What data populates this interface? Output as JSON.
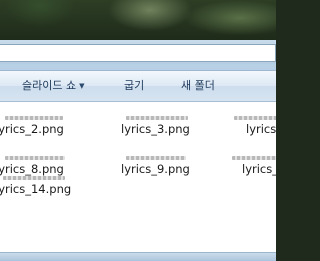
{
  "toolbar": {
    "slideshow_label": "슬라이드 쇼",
    "burn_label": "굽기",
    "new_folder_label": "새 폴더"
  },
  "files": [
    {
      "name": "lyrics_2.png"
    },
    {
      "name": "lyrics_3.png"
    },
    {
      "name": "lyrics_"
    },
    {
      "name": "lyrics_8.png"
    },
    {
      "name": "lyrics_9.png"
    },
    {
      "name": "lyrics_"
    },
    {
      "name": "lyrics_14.png"
    }
  ]
}
